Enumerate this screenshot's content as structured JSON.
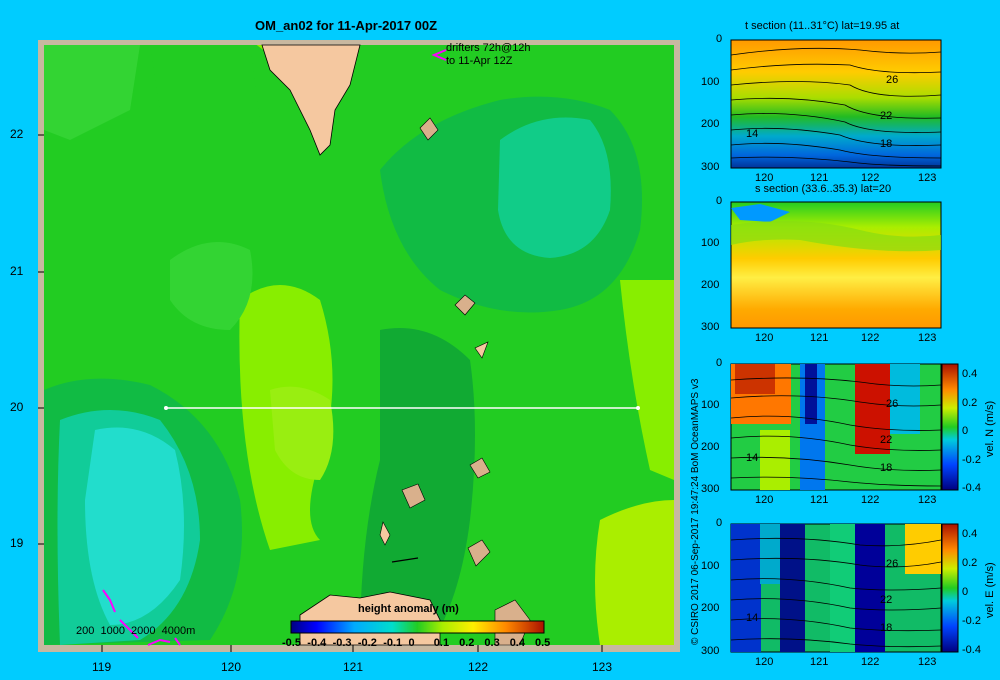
{
  "map": {
    "title": "OM_an02 for 11-Apr-2017 00Z",
    "drifters_line1": "drifters 72h@12h",
    "drifters_line2": "to 11-Apr 12Z",
    "depth_legend": "200  1000  2000  4000m",
    "lat_ticks": [
      "22",
      "21",
      "20",
      "19"
    ],
    "lon_ticks": [
      "119",
      "120",
      "121",
      "122",
      "123"
    ],
    "colorbar_title": "height anomaly (m)",
    "colorbar_ticks": [
      "-0.5",
      "-0.4",
      "-0.3",
      "-0.2",
      "-0.1",
      "0",
      "0.1",
      "0.2",
      "0.3",
      "0.4",
      "0.5"
    ],
    "colors": {
      "land": "#f5c8a0",
      "land_shade": "#d9b08c",
      "frame": "#c8b8a0",
      "drifter": "#ff00ff"
    }
  },
  "panels": [
    {
      "title": "t section (11..31°C) lat=19.95 at",
      "y_ticks": [
        "0",
        "100",
        "200",
        "300"
      ],
      "x_ticks": [
        "120",
        "121",
        "122",
        "123"
      ],
      "labels": [
        "26",
        "22",
        "18",
        "14"
      ],
      "colorbar": null
    },
    {
      "title": "s section (33.6..35.3) lat=20",
      "y_ticks": [
        "0",
        "100",
        "200",
        "300"
      ],
      "x_ticks": [
        "120",
        "121",
        "122",
        "123"
      ],
      "labels": [],
      "colorbar": null
    },
    {
      "title": "",
      "y_ticks": [
        "0",
        "100",
        "200",
        "300"
      ],
      "x_ticks": [
        "120",
        "121",
        "122",
        "123"
      ],
      "labels": [
        "26",
        "22",
        "18",
        "14"
      ],
      "colorbar": {
        "label": "vel. N (m/s)",
        "ticks": [
          "0.4",
          "0.2",
          "0",
          "-0.2",
          "-0.4"
        ]
      }
    },
    {
      "title": "",
      "y_ticks": [
        "0",
        "100",
        "200",
        "300"
      ],
      "x_ticks": [
        "120",
        "121",
        "122",
        "123"
      ],
      "labels": [
        "26",
        "22",
        "18",
        "14"
      ],
      "colorbar": {
        "label": "vel. E (m/s)",
        "ticks": [
          "0.4",
          "0.2",
          "0",
          "-0.2",
          "-0.4"
        ]
      }
    }
  ],
  "credit": "© CSIRO 2017   06-Sep-2017 19:47:24 BoM OceanMAPS v3"
}
